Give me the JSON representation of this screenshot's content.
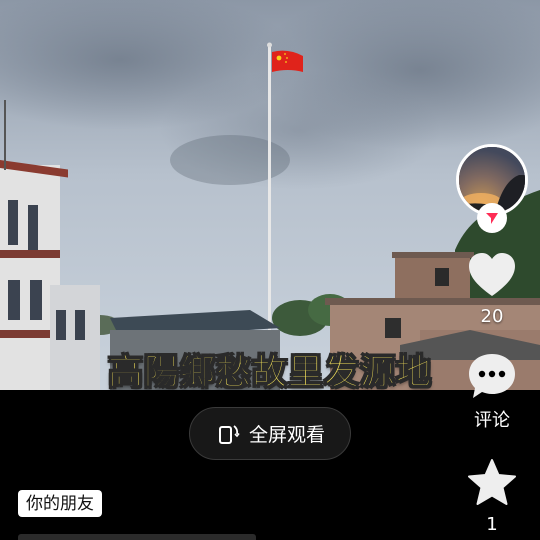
{
  "video": {
    "caption": "高陽鄉愁故里发源地"
  },
  "fullscreen": {
    "label": "全屏观看",
    "icon": "fullscreen-rotate-icon"
  },
  "side_actions": {
    "avatar_icon": "avatar-sunset",
    "follow_icon": "follow-arrow-icon",
    "like": {
      "icon": "heart-icon",
      "count": "20"
    },
    "comment": {
      "icon": "comment-bubble-icon",
      "label": "评论"
    },
    "favorite": {
      "icon": "star-icon",
      "count": "1"
    }
  },
  "friend_tag": {
    "label": "你的朋友"
  },
  "colors": {
    "caption_yellow": "#f5e25a",
    "follow_red": "#fe2c55",
    "flag_red": "#e0231b"
  }
}
